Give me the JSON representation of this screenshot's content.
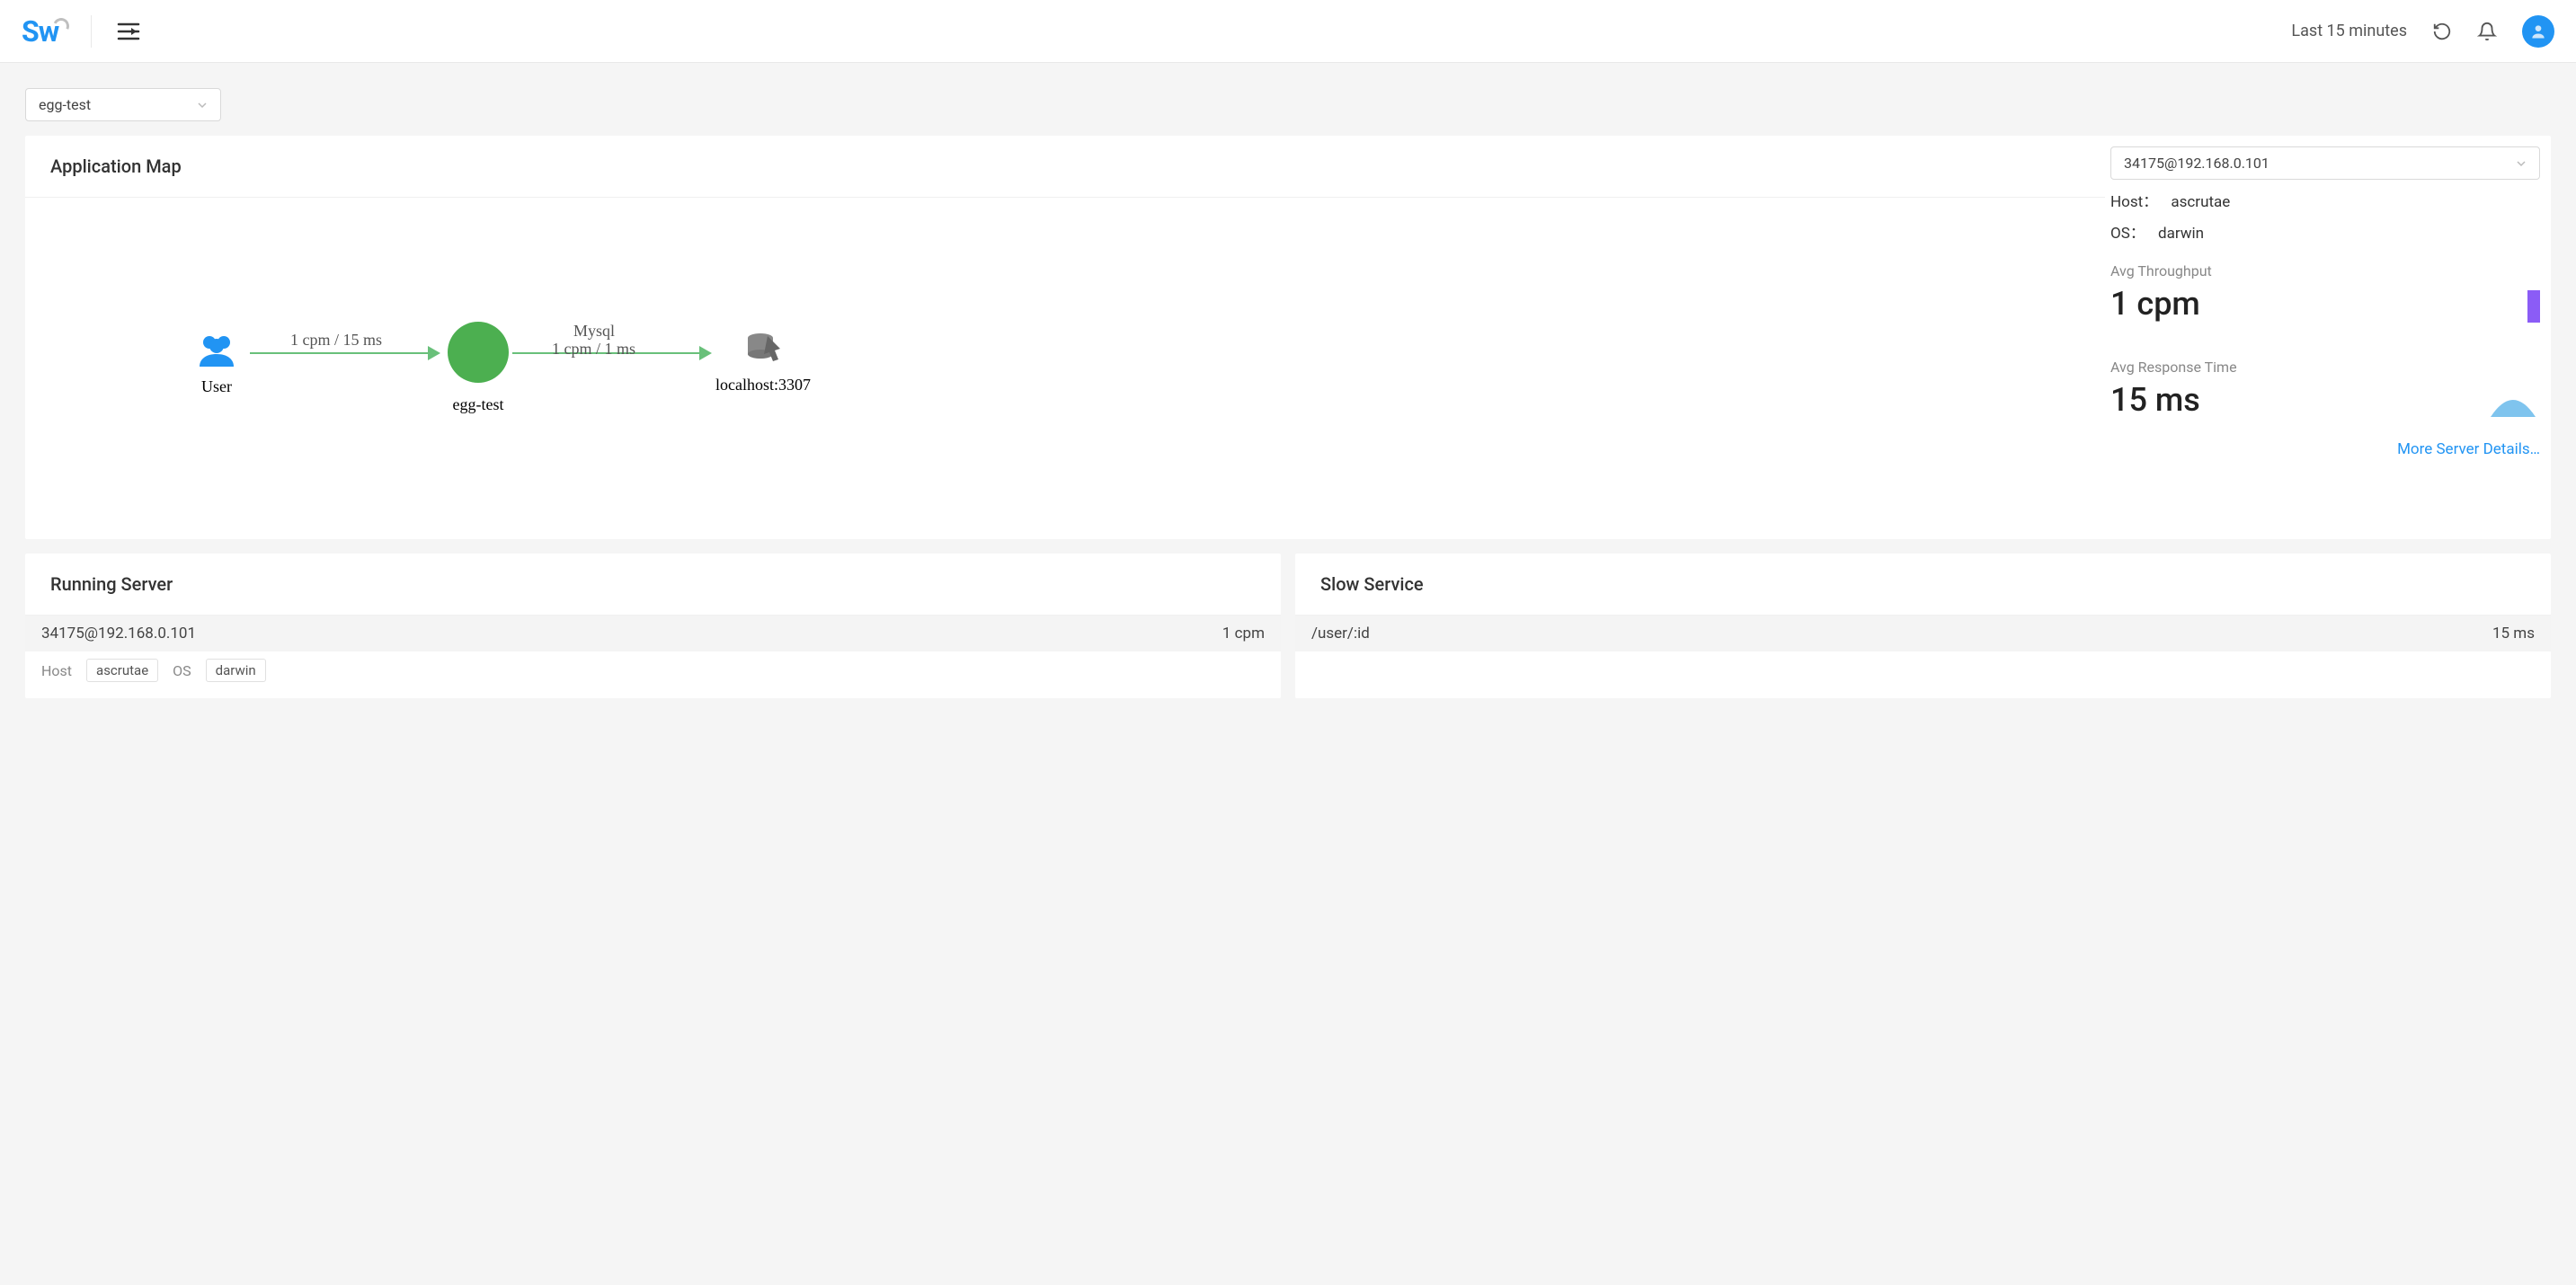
{
  "header": {
    "time_range": "Last 15 minutes"
  },
  "selector": {
    "app": "egg-test"
  },
  "app_map": {
    "title": "Application Map",
    "nodes": {
      "user": "User",
      "service": "egg-test",
      "db": "localhost:3307"
    },
    "edges": {
      "user_service": "1 cpm / 15 ms",
      "service_db_top": "Mysql",
      "service_db_bottom": "1 cpm / 1 ms"
    }
  },
  "side": {
    "instance": "34175@192.168.0.101",
    "host_label": "Host：",
    "host_value": "ascrutae",
    "os_label": "OS：",
    "os_value": "darwin",
    "throughput_label": "Avg Throughput",
    "throughput_value": "1 cpm",
    "response_label": "Avg Response Time",
    "response_value": "15 ms",
    "more_link": "More Server Details…"
  },
  "running_server": {
    "title": "Running Server",
    "row_name": "34175@192.168.0.101",
    "row_value": "1 cpm",
    "host_label": "Host",
    "host_value": "ascrutae",
    "os_label": "OS",
    "os_value": "darwin"
  },
  "slow_service": {
    "title": "Slow Service",
    "row_name": "/user/:id",
    "row_value": "15 ms"
  }
}
